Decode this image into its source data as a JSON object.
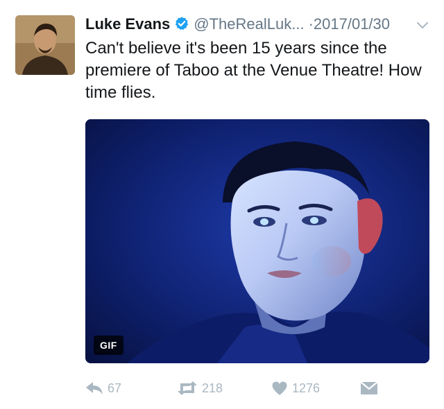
{
  "user": {
    "display_name": "Luke Evans",
    "handle": "@TheRealLuk...",
    "separator": "·",
    "date": "2017/01/30",
    "verified": true
  },
  "tweet": {
    "text": "Can't believe it's been 15 years since the premiere of Taboo at the Venue Theatre! How time flies."
  },
  "media": {
    "type": "gif",
    "badge_label": "GIF"
  },
  "actions": {
    "reply_count": "67",
    "retweet_count": "218",
    "like_count": "1276"
  },
  "colors": {
    "text": "#14171a",
    "secondary": "#657786",
    "action_gray": "#aab8c2",
    "verified_blue": "#1da1f2",
    "media_background": "#0a1852"
  },
  "icons": [
    "verified-badge-icon",
    "chevron-down-icon",
    "reply-icon",
    "retweet-icon",
    "heart-icon",
    "direct-message-icon"
  ]
}
